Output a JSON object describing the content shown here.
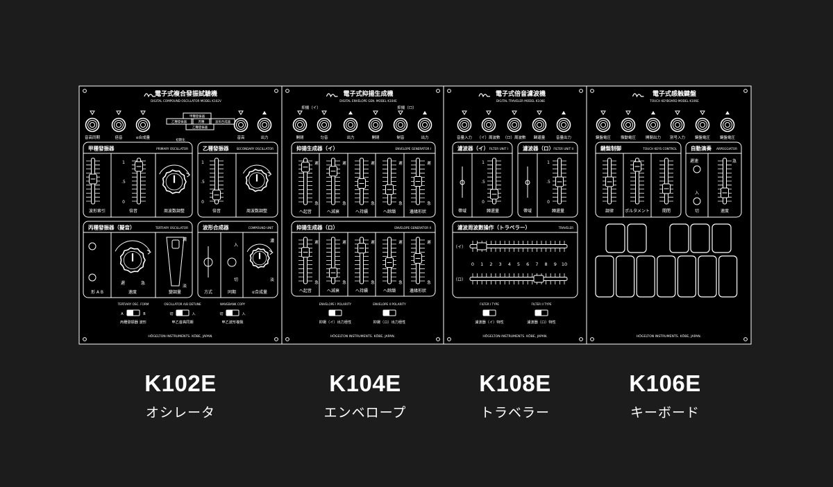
{
  "modules": [
    {
      "model": "K102E",
      "name": "オシレータ",
      "title": "電子式複合發振試驗機",
      "subtitle": "DIGITAL COMPOUND OSCILLATOR MODEL K102V",
      "jacks": [
        "音高同期",
        "倍音",
        "α合成量",
        "音高",
        "出力"
      ],
      "routing": [
        "甲種發振器",
        "乙種發振器",
        "丙種",
        "波形合成器",
        "乙種發振器"
      ],
      "routing_note": "初期化",
      "sections": [
        {
          "title": "甲種發振器",
          "en": "PRIMARY OSCILLATOR",
          "labels": [
            "波形索引",
            "倍音",
            "周波数調整"
          ]
        },
        {
          "title": "乙種發振器",
          "en": "SECONDARY OSCILLATOR",
          "labels": [
            "倍音",
            "周波数調整"
          ]
        },
        {
          "title": "丙種發振器（擬音）",
          "en": "TERTIARY OSCILLATOR",
          "labels": [
            "形 A B",
            "遲",
            "急",
            "速度",
            "濃",
            "淡",
            "變調量"
          ]
        },
        {
          "title": "波形合成器",
          "en": "COMPOUND UNIT",
          "labels": [
            "入",
            "切",
            "方式",
            "同期",
            "α合成量",
            "濃",
            "淡"
          ]
        }
      ],
      "scale": [
        "1",
        "0",
        ".5",
        "0"
      ],
      "switches": [
        {
          "en": "TERTIARY OSC. FORM",
          "a": "A",
          "b": "B",
          "label": "丙種發振器 波形"
        },
        {
          "en": "OSCILLATOR A/B DETUNE",
          "a": "切",
          "b": "入",
          "label": "甲乙音高同期"
        },
        {
          "en": "WAVEBANK COPY",
          "a": "切",
          "b": "入",
          "label": "甲乙波形複製"
        }
      ],
      "footer": "HŌGELTON INSTRUMENTS. KŌBE, JAPAN."
    },
    {
      "model": "K104E",
      "name": "エンベロープ",
      "title": "電子式抑揚生成機",
      "subtitle": "DIGITAL ENVELOPE GEN. MODEL K104E",
      "groups": [
        "抑揚（イ）",
        "抑揚（ロ）"
      ],
      "jacks": [
        "開閉",
        "匀音",
        "出力",
        "開閉",
        "制音",
        "出力"
      ],
      "sections": [
        {
          "title": "抑揚生成器（イ）",
          "en": "ENVELOPE GENERATOR I",
          "labels": [
            "へ起音",
            "へ減衰",
            "へ持續",
            "へ餘韻",
            "邊緣形狀"
          ]
        },
        {
          "title": "抑揚生成器（ロ）",
          "en": "ENVELOPE GENERATOR II",
          "labels": [
            "へ起音",
            "へ減衰",
            "へ持續",
            "へ餘韻",
            "邊緣形狀"
          ]
        }
      ],
      "slow": "遲",
      "fast": "急",
      "switches": [
        {
          "en": "ENVELOPE I POLARITY",
          "label": "抑揚（イ）出力極性"
        },
        {
          "en": "ENVELOPE II POLARITY",
          "label": "抑揚（ロ）出力極性"
        }
      ],
      "footer": "HŌGELTON INSTRUMENTS. KŌBE, JAPAN."
    },
    {
      "model": "K108E",
      "name": "トラベラー",
      "title": "電子式倍音濾波機",
      "subtitle": "DIGITAL TRAVELER MODEL K108E",
      "jacks": [
        "音量入力",
        "（イ）周波數",
        "（ロ）周波數",
        "歸還量",
        "音量出力"
      ],
      "sections": [
        {
          "title": "濾波器（イ）",
          "en": "FILTER UNIT I",
          "labels": [
            "帶域",
            "歸還量"
          ]
        },
        {
          "title": "濾波器（ロ）",
          "en": "FILTER UNIT II",
          "labels": [
            "帶域",
            "歸還量"
          ]
        },
        {
          "title": "濾波周波數操作（トラベラー）",
          "en": "TRAVELER",
          "labels": [
            "（イ）",
            "（ロ）"
          ]
        }
      ],
      "scale": [
        "1",
        ".5",
        "0"
      ],
      "numbers": [
        "0",
        "1",
        "2",
        "3",
        "4",
        "5",
        "6",
        "7",
        "8",
        "9",
        "10"
      ],
      "switches": [
        {
          "en": "FILTER I TYPE",
          "label": "濾波器（イ）特性"
        },
        {
          "en": "FILTER II TYPE",
          "label": "濾波器（ロ）特性"
        }
      ],
      "footer": "HŌGELTON INSTRUMENTS. KŌBE, JAPAN."
    },
    {
      "model": "K106E",
      "name": "キーボード",
      "title": "電子式感触鍵盤",
      "subtitle": "TOUCH KEYBOARD MODEL K106E",
      "jacks": [
        "鍵盤電圧",
        "振動電圧",
        "開閉出力",
        "別号入力",
        "鍵盤電圧",
        "鍵盤電圧"
      ],
      "sections": [
        {
          "title": "鍵盤制御",
          "en": "TOUCH KEYS CONTROL",
          "labels": [
            "調律",
            "ポルタメント",
            "開閉"
          ]
        },
        {
          "title": "自動演奏",
          "en": "ARPEGGIATOR",
          "labels": [
            "遲速",
            "入",
            "切",
            "速度",
            "急"
          ]
        }
      ],
      "footer": "HŌGELTON INSTRUMENTS. KŌBE, JAPAN."
    }
  ],
  "colors": {
    "background": "#1c1c1c",
    "panel": "#000000",
    "line": "#ffffff"
  }
}
